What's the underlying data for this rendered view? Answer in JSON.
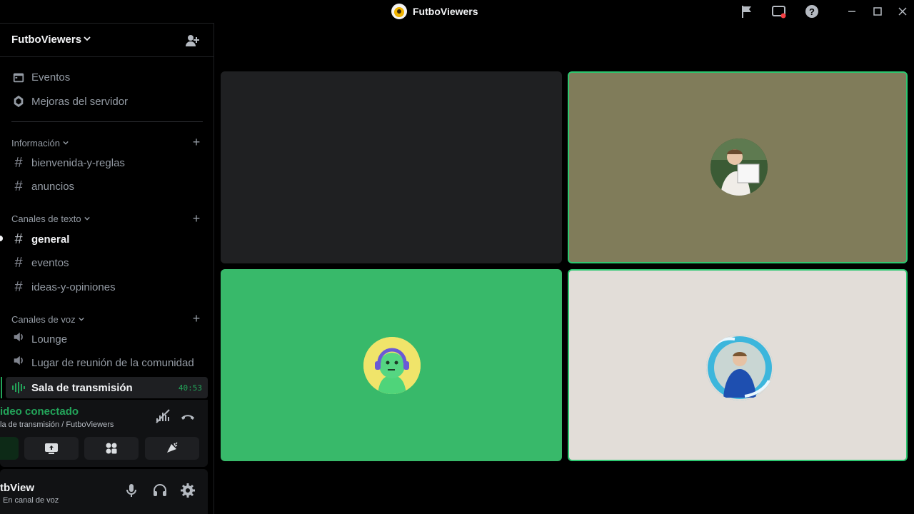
{
  "window": {
    "title": "FutboViewers",
    "controls": [
      "minimize",
      "maximize",
      "close"
    ]
  },
  "server": {
    "name": "FutboViewers"
  },
  "nav": [
    {
      "label": "Eventos",
      "icon": "calendar-icon"
    },
    {
      "label": "Mejoras del servidor",
      "icon": "boost-icon"
    }
  ],
  "categories": {
    "info": {
      "label": "Información",
      "channels": [
        "bienvenida-y-reglas",
        "anuncios"
      ]
    },
    "text": {
      "label": "Canales de texto",
      "channels": [
        "general",
        "eventos",
        "ideas-y-opiniones"
      ],
      "active": "general"
    },
    "voice": {
      "label": "Canales de voz",
      "channels": [
        "Lounge",
        "Lugar de reunión de la comunidad"
      ],
      "active_channel": "Sala de transmisión",
      "timer": "40:53"
    }
  },
  "voice_panel": {
    "status": "ideo conectado",
    "subtitle": "la de transmisión / FutboViewers"
  },
  "user": {
    "name": "tbView",
    "status": "En canal de voz"
  },
  "colors": {
    "accent_green": "#23a55a",
    "speaking_border": "#2dc770",
    "tile_olive": "#807c5a",
    "tile_green": "#38b96a",
    "tile_light": "#e2ddd8",
    "tile_dark": "#1f2022"
  },
  "video_tiles": [
    {
      "speaking": false,
      "has_avatar": false
    },
    {
      "speaking": true,
      "has_avatar": true
    },
    {
      "speaking": false,
      "has_avatar": true
    },
    {
      "speaking": true,
      "has_avatar": true
    }
  ]
}
